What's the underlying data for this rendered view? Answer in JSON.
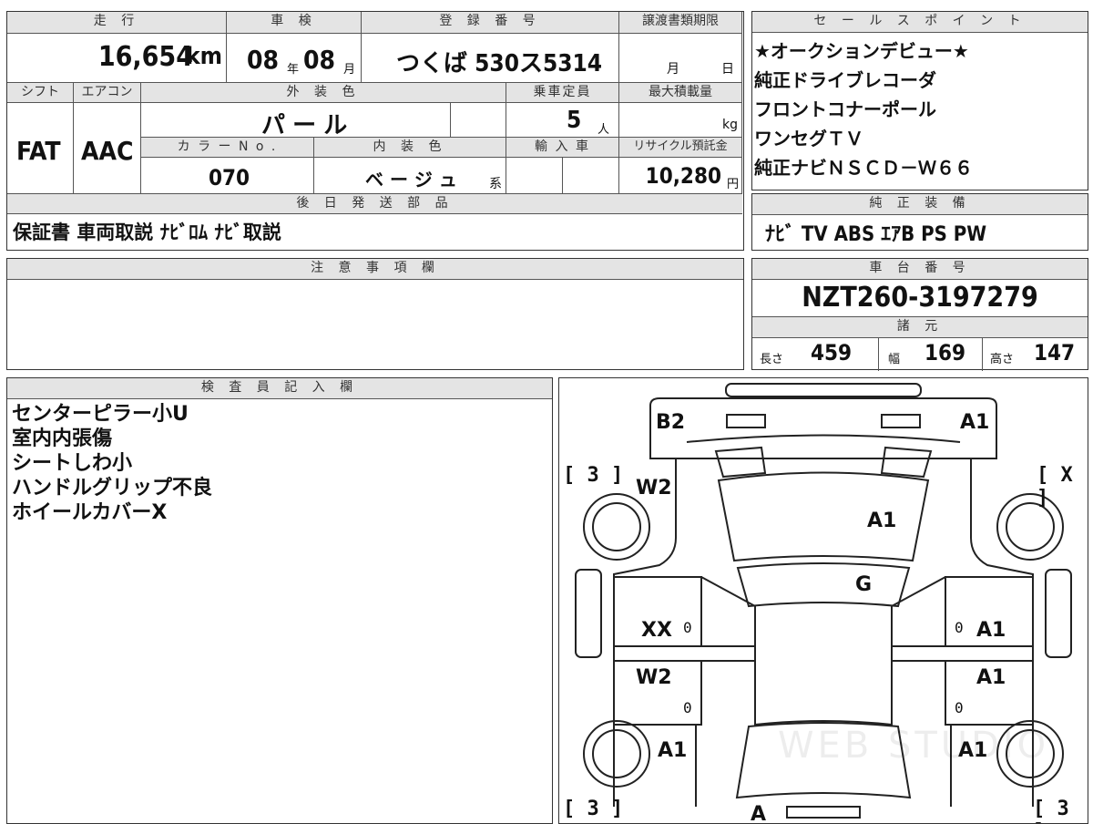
{
  "top_table": {
    "headers": {
      "mileage": "走 行",
      "inspection": "車 検",
      "registration": "登 録 番 号",
      "transfer_deadline": "譲渡書類期限",
      "shift": "シフト",
      "aircon": "エアコン",
      "exterior_color": "外 装 色",
      "capacity": "乗車定員",
      "max_load": "最大積載量",
      "color_no": "カ ラ ー N o .",
      "interior_color": "内 装 色",
      "import": "輸 入 車",
      "recycle": "リサイクル預託金",
      "later_parts": "後 日 発 送 部 品"
    },
    "mileage_value": "16,654",
    "mileage_unit": "km",
    "inspection_year": "08",
    "year_unit": "年",
    "inspection_month": "08",
    "month_unit": "月",
    "registration_value": "つくば 530ス5314",
    "deadline_month": "月",
    "deadline_day": "日",
    "shift_value": "FAT",
    "aircon_value": "AAC",
    "exterior_value": "パ ー ル",
    "capacity_value": "5",
    "capacity_unit": "人",
    "max_load_unit": "kg",
    "color_no_value": "070",
    "interior_value": "ベ ー ジ ュ",
    "interior_suffix": "系",
    "recycle_value": "10,280",
    "recycle_unit": "円",
    "later_parts_value": "保証書 車両取説 ﾅﾋﾞﾛﾑ ﾅﾋﾞ取説"
  },
  "sales_points": {
    "header": "セ ー ル ス ポ イ ン ト",
    "items": [
      "★オークションデビュー★",
      "純正ドライブレコーダ",
      "フロントコナーポール",
      "ワンセグＴＶ",
      "純正ナビＮＳＣＤ－Ｗ６６"
    ]
  },
  "equipment": {
    "header": "純 正 装 備",
    "value": "ﾅﾋﾞ TV ABS ｴｱB PS PW"
  },
  "notes": {
    "header": "注 意 事 項 欄",
    "value": ""
  },
  "chassis": {
    "header": "車 台 番 号",
    "value": "NZT260-3197279"
  },
  "specs": {
    "header": "諸 元",
    "length_label": "長さ",
    "length": "459",
    "width_label": "幅",
    "width": "169",
    "height_label": "高さ",
    "height": "147"
  },
  "inspector": {
    "header": "検 査 員 記 入 欄",
    "lines": [
      "センターピラー小U",
      "室内内張傷",
      "シートしわ小",
      "ハンドルグリップ不良",
      "ホイールカバーX"
    ]
  },
  "diagram": {
    "marks": {
      "rear_left": "B2",
      "rear_right": "A1",
      "trunk": "A1",
      "rear_glass": "G",
      "rear_left_door": "W2",
      "rear_left_door2": "XX",
      "front_left_door": "W2",
      "front_left_fender": "A1",
      "rear_right_door": "A1",
      "front_right_door": "A1",
      "front_right_fender": "A1",
      "front_bumper": "A",
      "zero": "0"
    },
    "tires": {
      "rear_left": "3",
      "rear_right": "X",
      "front_left": "3",
      "front_right": "3"
    },
    "watermark": "WEB STUDIO"
  }
}
